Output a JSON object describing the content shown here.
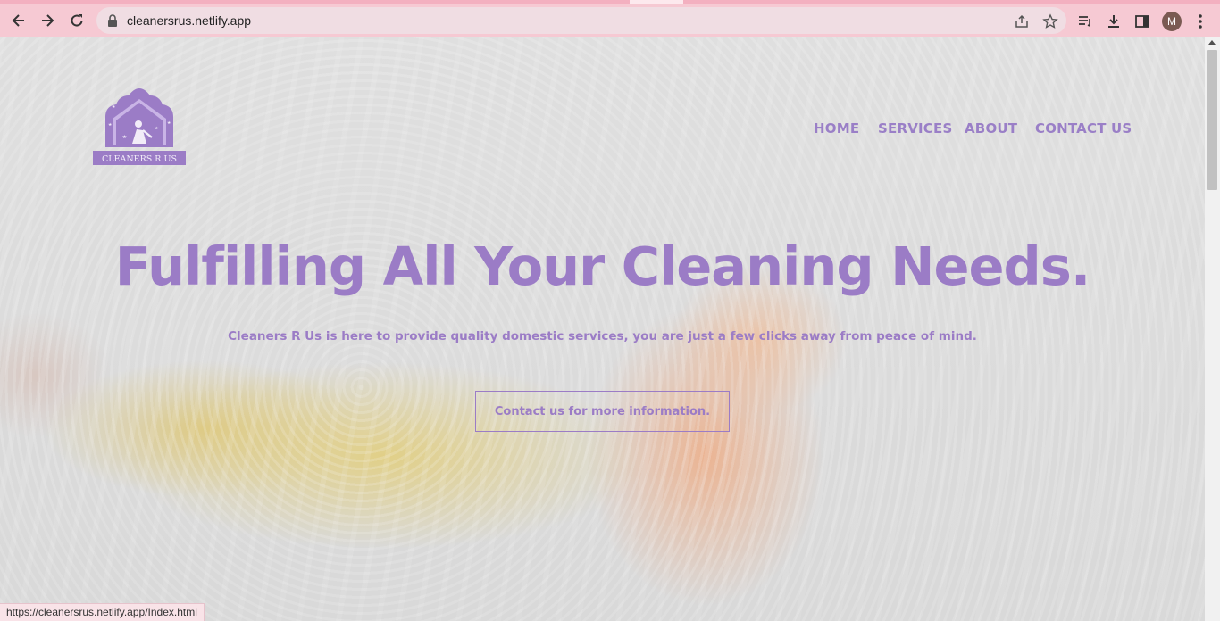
{
  "browser": {
    "url": "cleanersrus.netlify.app",
    "avatar_letter": "M",
    "icons": {
      "back": "back-arrow-icon",
      "forward": "forward-arrow-icon",
      "reload": "reload-icon",
      "lock": "lock-icon",
      "share": "share-icon",
      "bookmark": "star-icon",
      "reading_list": "reading-list-icon",
      "download": "download-icon",
      "side_panel": "side-panel-icon",
      "menu": "kebab-menu-icon"
    },
    "theme_color": "#f6c9d3"
  },
  "site": {
    "logo_text": "CLEANERS R US",
    "nav": {
      "home": "HOME",
      "services": "SERVICES",
      "about": "ABOUT",
      "contact": "CONTACT US"
    },
    "hero": {
      "title": "Fulfilling All Your Cleaning Needs.",
      "subtitle": "Cleaners R Us is here to provide quality domestic services, you are just a few clicks away from peace of mind.",
      "cta": "Contact us for more information."
    },
    "accent_color": "#9b7cc6"
  },
  "status_bar": {
    "link": "https://cleanersrus.netlify.app/Index.html"
  }
}
